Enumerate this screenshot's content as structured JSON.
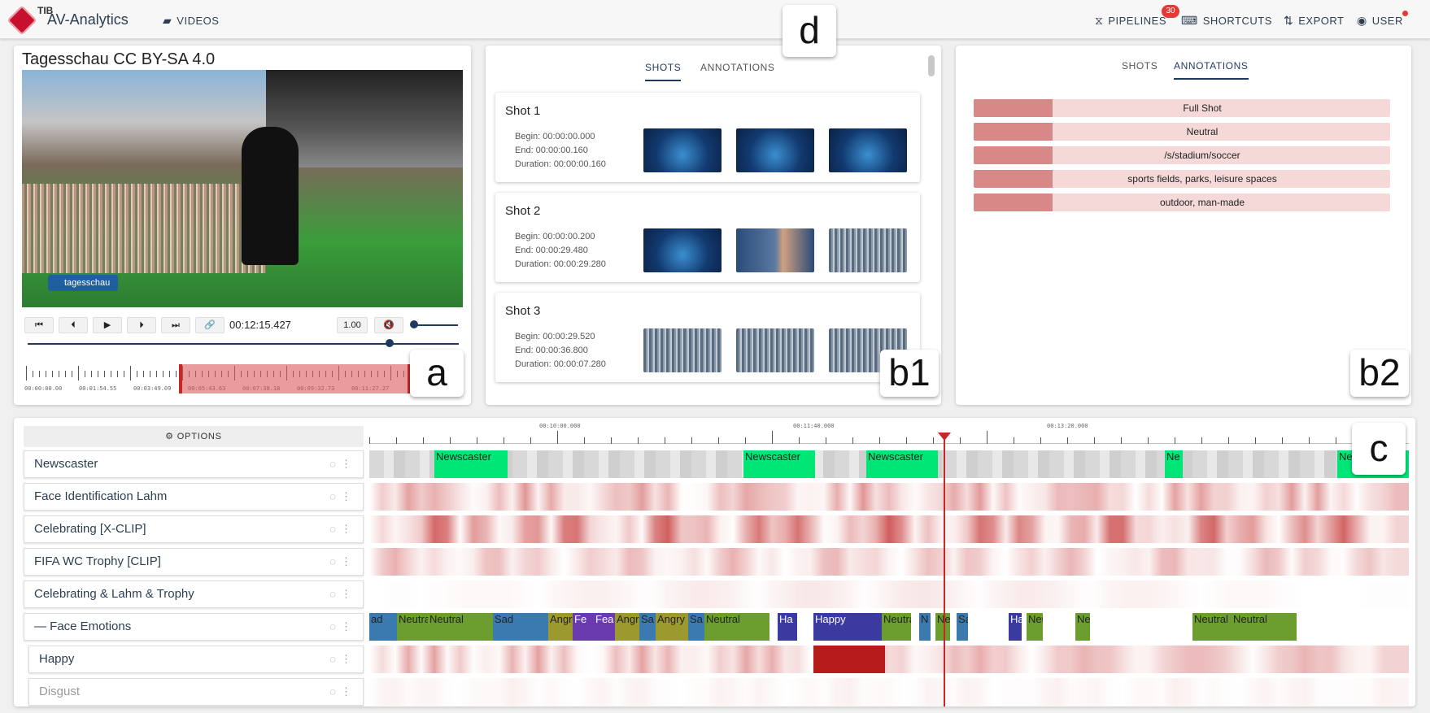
{
  "topbar": {
    "logo_text": "TIB",
    "app_title": "AV-Analytics",
    "videos_label": "VIDEOS",
    "pipelines_label": "PIPELINES",
    "pipelines_badge": "30",
    "shortcuts_label": "SHORTCUTS",
    "export_label": "EXPORT",
    "user_label": "USER"
  },
  "figure_labels": {
    "a": "a",
    "b1": "b1",
    "b2": "b2",
    "c": "c",
    "d": "d"
  },
  "player": {
    "title": "Tagesschau CC BY-SA 4.0",
    "channel_tag": "tagesschau",
    "current_time": "00:12:15.427",
    "speed": "1.00",
    "position_fraction": 0.84,
    "volume_fraction": 0.02,
    "ruler_labels": [
      "00:00:00.00",
      "00:01:54.55",
      "00:03:49.09",
      "00:05:43.63",
      "00:07:38.18",
      "00:09:32.73",
      "00:11:27.27"
    ]
  },
  "shots_panel": {
    "tab_shots": "SHOTS",
    "tab_annotations": "ANNOTATIONS",
    "shots": [
      {
        "title": "Shot 1",
        "begin": "Begin: 00:00:00.000",
        "end": "End: 00:00:00.160",
        "duration": "Duration: 00:00:00.160"
      },
      {
        "title": "Shot 2",
        "begin": "Begin: 00:00:00.200",
        "end": "End: 00:00:29.480",
        "duration": "Duration: 00:00:29.280"
      },
      {
        "title": "Shot 3",
        "begin": "Begin: 00:00:29.520",
        "end": "End: 00:00:36.800",
        "duration": "Duration: 00:00:07.280"
      }
    ]
  },
  "annotations_panel": {
    "tab_shots": "SHOTS",
    "tab_annotations": "ANNOTATIONS",
    "items": [
      "Full Shot",
      "Neutral",
      "/s/stadium/soccer",
      "sports fields, parks, leisure spaces",
      "outdoor, man-made"
    ]
  },
  "timeline": {
    "options_label": "OPTIONS",
    "ruler_labels": [
      "00:10:00.000",
      "00:11:40.000",
      "00:13:20.000"
    ],
    "tracks": [
      "Newscaster",
      "Face Identification Lahm",
      "Celebrating [X-CLIP]",
      "FIFA WC Trophy [CLIP]",
      "Celebrating & Lahm & Trophy",
      "— Face Emotions",
      "Happy",
      "Disgust"
    ],
    "newscaster_segments": [
      "Newscaster",
      "Newscaster",
      "Newscaster",
      "Ne",
      "New"
    ],
    "emotion_segments": [
      "ad",
      "Neutra",
      "Neutral",
      "Sad",
      "Angr",
      "Fe",
      "Fea",
      "Angr",
      "Sa",
      "Angry",
      "Sa",
      "Neutral",
      "Ha",
      "Happy",
      "Neutra",
      "N",
      "Ne",
      "Sa",
      "Ha",
      "Neu",
      "Ne",
      "Neutral",
      "Neutral"
    ]
  },
  "colors": {
    "accent": "#1f3a5f",
    "newscaster": "#00e676",
    "heat_strong": "#b71c1c",
    "neutral": "#6b9e2f",
    "sad": "#3a7aaf",
    "angry": "#9c9a2e",
    "fear": "#6a3aaf",
    "happy": "#3a3aa0"
  }
}
